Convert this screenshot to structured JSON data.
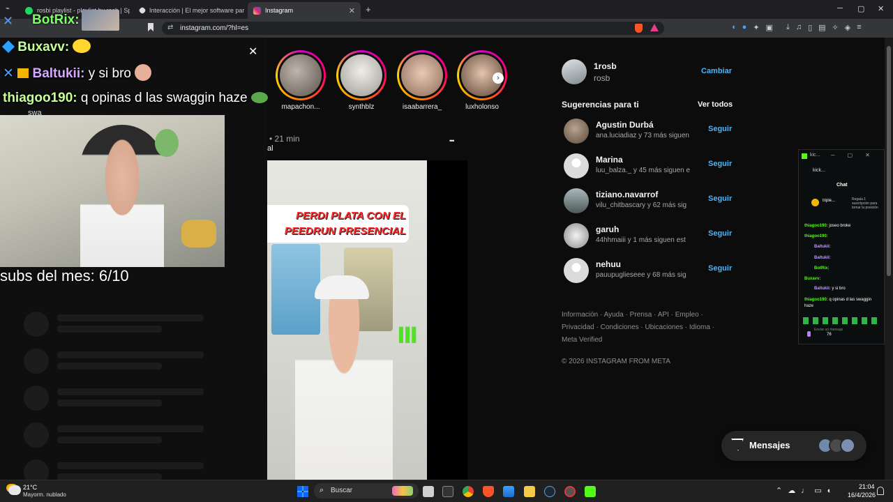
{
  "browser": {
    "tabs": [
      {
        "title": "rosbi playlist - playlist by rosb | Spot",
        "favicon_color": "#1ed760"
      },
      {
        "title": "Interacción | El mejor software para g",
        "favicon_color": "#dddddd"
      },
      {
        "title": "Instagram",
        "favicon_color": "#e1306c"
      }
    ],
    "new_tab": "+",
    "url": "instagram.com/?hl=es",
    "window_controls": {
      "minimize": "─",
      "maximize": "▢",
      "close": "✕"
    }
  },
  "stream_overlay": {
    "bot_name": "BotRix:",
    "chat": [
      {
        "user": "Buxavv:",
        "message": ""
      },
      {
        "user": "Baltukii:",
        "message": "y si bro"
      },
      {
        "user": "thiagoo190:",
        "message": "q opinas d las swaggin haze"
      }
    ],
    "typing": "swa",
    "subs_text": "subs del mes: 6/10",
    "close_icon": "✕"
  },
  "stories": [
    {
      "name": "mapachon...",
      "color": "#7d6f68"
    },
    {
      "name": "synthblz",
      "color": "#c8c5bf"
    },
    {
      "name": "isaabarrera_",
      "color": "#d4b5a2"
    },
    {
      "name": "luxholonso",
      "color": "#b49a86"
    }
  ],
  "post": {
    "time": "• 21 min",
    "subtitle_fragment": "al",
    "more": "•••",
    "banner_line1": "PERDI PLATA CON EL",
    "banner_line2": "PEEDRUN PRESENCIAL"
  },
  "profile": {
    "username": "1rosb",
    "name": "rosb",
    "switch_label": "Cambiar"
  },
  "suggestions": {
    "title": "Sugerencias para ti",
    "see_all": "Ver todos",
    "follow_label": "Seguir",
    "items": [
      {
        "user": "Agustin Durbá",
        "sub": "ana.luciadiaz y 73 más siguen",
        "color": "#8a7a6a"
      },
      {
        "user": "Marina",
        "sub": "luu_balza._ y 45 más siguen e",
        "color": "#dbdbdb"
      },
      {
        "user": "tiziano.navarrof",
        "sub": "vilu_chitbascary y 62 más sig",
        "color": "#7b8a8c"
      },
      {
        "user": "garuh",
        "sub": "44hhmaiii y 1 más siguen est",
        "color": "#cfcfcf"
      },
      {
        "user": "nehuu",
        "sub": "pauupuglieseee y 68 más sig",
        "color": "#dbdbdb"
      }
    ]
  },
  "footer": {
    "line1": [
      "Información",
      "Ayuda",
      "Prensa",
      "API",
      "Empleo"
    ],
    "line2": [
      "Privacidad",
      "Condiciones",
      "Ubicaciones",
      "Idioma"
    ],
    "line3": "Meta Verified",
    "copyright": "© 2026 INSTAGRAM FROM META"
  },
  "kick_popup": {
    "title": "kic...",
    "tab": "kick...",
    "chat_header": "Chat",
    "pinned": "triple...",
    "pinned_note": "Regala 1 suscripción para tomar la posición",
    "messages": [
      {
        "user": "thiagoo190:",
        "message": "joseo broke"
      },
      {
        "user": "thiagoo190:",
        "message": ""
      },
      {
        "user": "Baltukii:",
        "message": ""
      },
      {
        "user": "Baltukii:",
        "message": ""
      },
      {
        "user": "BotRix:",
        "message": ""
      },
      {
        "user": "Buxavv:",
        "message": ""
      },
      {
        "user": "Baltukii:",
        "message": "y si bro"
      },
      {
        "user": "thiagoo190:",
        "message": "q opinas d las swaggin haze"
      }
    ],
    "input_placeholder": "Enviar un mensaje",
    "count": "76"
  },
  "messages_button": {
    "label": "Mensajes"
  },
  "taskbar": {
    "weather_temp": "21°C",
    "weather_desc": "Mayorm. nublado",
    "search_label": "Buscar",
    "time": "21:04",
    "date": "16/4/2026"
  }
}
